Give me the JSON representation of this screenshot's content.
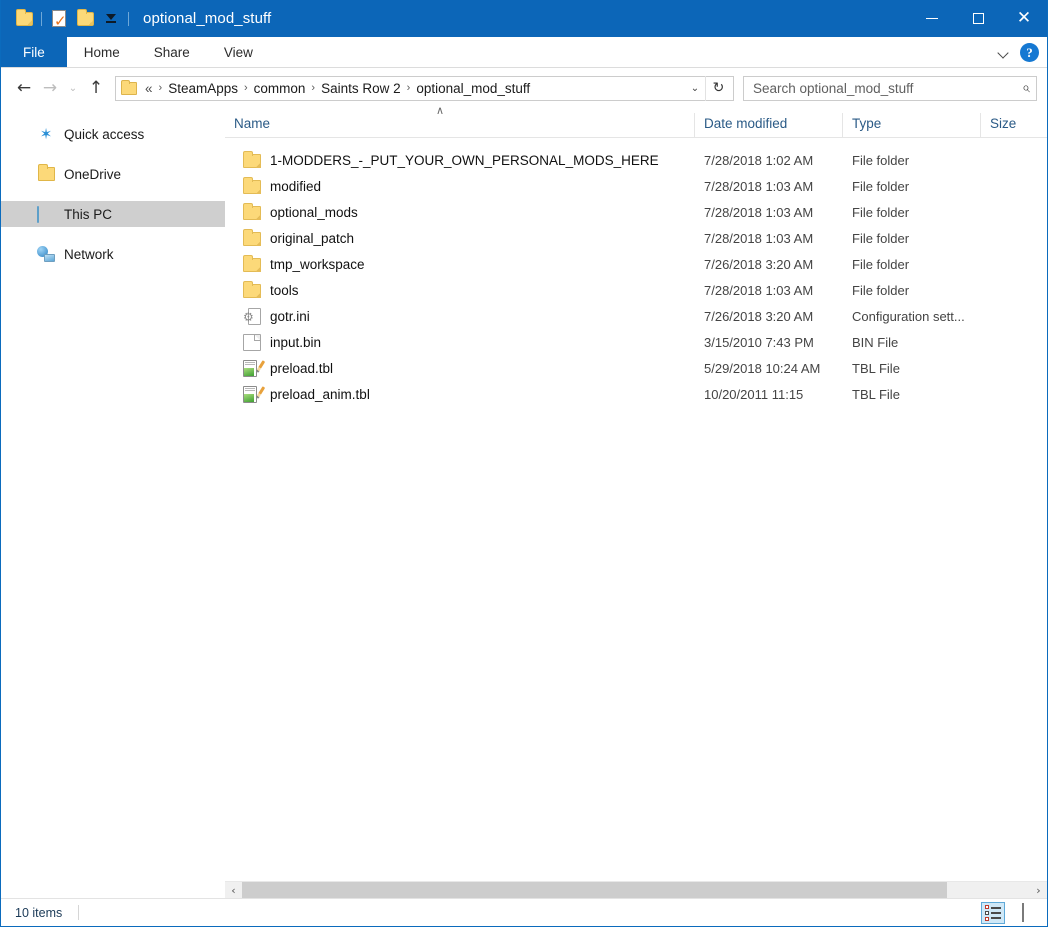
{
  "window": {
    "title": "optional_mod_stuff",
    "quick_access_toolbar": [
      {
        "name": "folder-properties-icon",
        "label": "Properties"
      },
      {
        "name": "new-folder-icon",
        "label": "New folder"
      },
      {
        "name": "customize-quick-access-icon",
        "label": "Customize Quick Access Toolbar"
      }
    ],
    "controls": {
      "minimize": "–",
      "maximize": "□",
      "close": "✕"
    }
  },
  "ribbon": {
    "tabs": [
      {
        "label": "File",
        "active": true
      },
      {
        "label": "Home",
        "active": false
      },
      {
        "label": "Share",
        "active": false
      },
      {
        "label": "View",
        "active": false
      }
    ],
    "expand_chevron": "∨",
    "help_label": "?"
  },
  "address_bar": {
    "back": "←",
    "forward": "→",
    "recent": "⌄",
    "up": "↑",
    "crumb_prefix": "«",
    "crumbs": [
      "SteamApps",
      "common",
      "Saints Row 2",
      "optional_mod_stuff"
    ],
    "separator": "›",
    "dropdown_caret": "⌄",
    "refresh": "↻"
  },
  "search": {
    "placeholder": "Search optional_mod_stuff",
    "value": "",
    "icon": "⌕"
  },
  "nav_pane": {
    "items": [
      {
        "label": "Quick access",
        "icon": "star-icon",
        "selected": false
      },
      {
        "label": "OneDrive",
        "icon": "folder-icon",
        "selected": false
      },
      {
        "label": "This PC",
        "icon": "computer-icon",
        "selected": true
      },
      {
        "label": "Network",
        "icon": "network-icon",
        "selected": false
      }
    ]
  },
  "file_list": {
    "sort_indicator": "∧",
    "columns": [
      {
        "key": "name",
        "label": "Name"
      },
      {
        "key": "date",
        "label": "Date modified"
      },
      {
        "key": "type",
        "label": "Type"
      },
      {
        "key": "size",
        "label": "Size"
      }
    ],
    "rows": [
      {
        "name": "1-MODDERS_-_PUT_YOUR_OWN_PERSONAL_MODS_HERE",
        "date": "7/28/2018 1:02 AM",
        "type": "File folder",
        "size": "",
        "icon": "folder"
      },
      {
        "name": "modified",
        "date": "7/28/2018 1:03 AM",
        "type": "File folder",
        "size": "",
        "icon": "folder"
      },
      {
        "name": "optional_mods",
        "date": "7/28/2018 1:03 AM",
        "type": "File folder",
        "size": "",
        "icon": "folder"
      },
      {
        "name": "original_patch",
        "date": "7/28/2018 1:03 AM",
        "type": "File folder",
        "size": "",
        "icon": "folder"
      },
      {
        "name": "tmp_workspace",
        "date": "7/26/2018 3:20 AM",
        "type": "File folder",
        "size": "",
        "icon": "folder"
      },
      {
        "name": "tools",
        "date": "7/28/2018 1:03 AM",
        "type": "File folder",
        "size": "",
        "icon": "folder"
      },
      {
        "name": "gotr.ini",
        "date": "7/26/2018 3:20 AM",
        "type": "Configuration sett...",
        "size": "",
        "icon": "ini"
      },
      {
        "name": "input.bin",
        "date": "3/15/2010 7:43 PM",
        "type": "BIN File",
        "size": "",
        "icon": "doc"
      },
      {
        "name": "preload.tbl",
        "date": "5/29/2018 10:24 AM",
        "type": "TBL File",
        "size": "",
        "icon": "tbl"
      },
      {
        "name": "preload_anim.tbl",
        "date": "10/20/2011 11:15",
        "type": "TBL File",
        "size": "",
        "icon": "tbl"
      }
    ]
  },
  "scrollbar": {
    "left_arrow": "‹",
    "right_arrow": "›"
  },
  "status_bar": {
    "item_count": "10 items",
    "views": [
      {
        "name": "details-view-button",
        "label": "Details view",
        "active": true
      },
      {
        "name": "large-icons-view-button",
        "label": "Large icons view",
        "active": false
      }
    ]
  },
  "colors": {
    "titlebar": "#0c66b8",
    "accent": "#0c66b8",
    "column_header_text": "#2a5a86",
    "selection": "#cfcfcf",
    "folder": "#fcd979"
  }
}
